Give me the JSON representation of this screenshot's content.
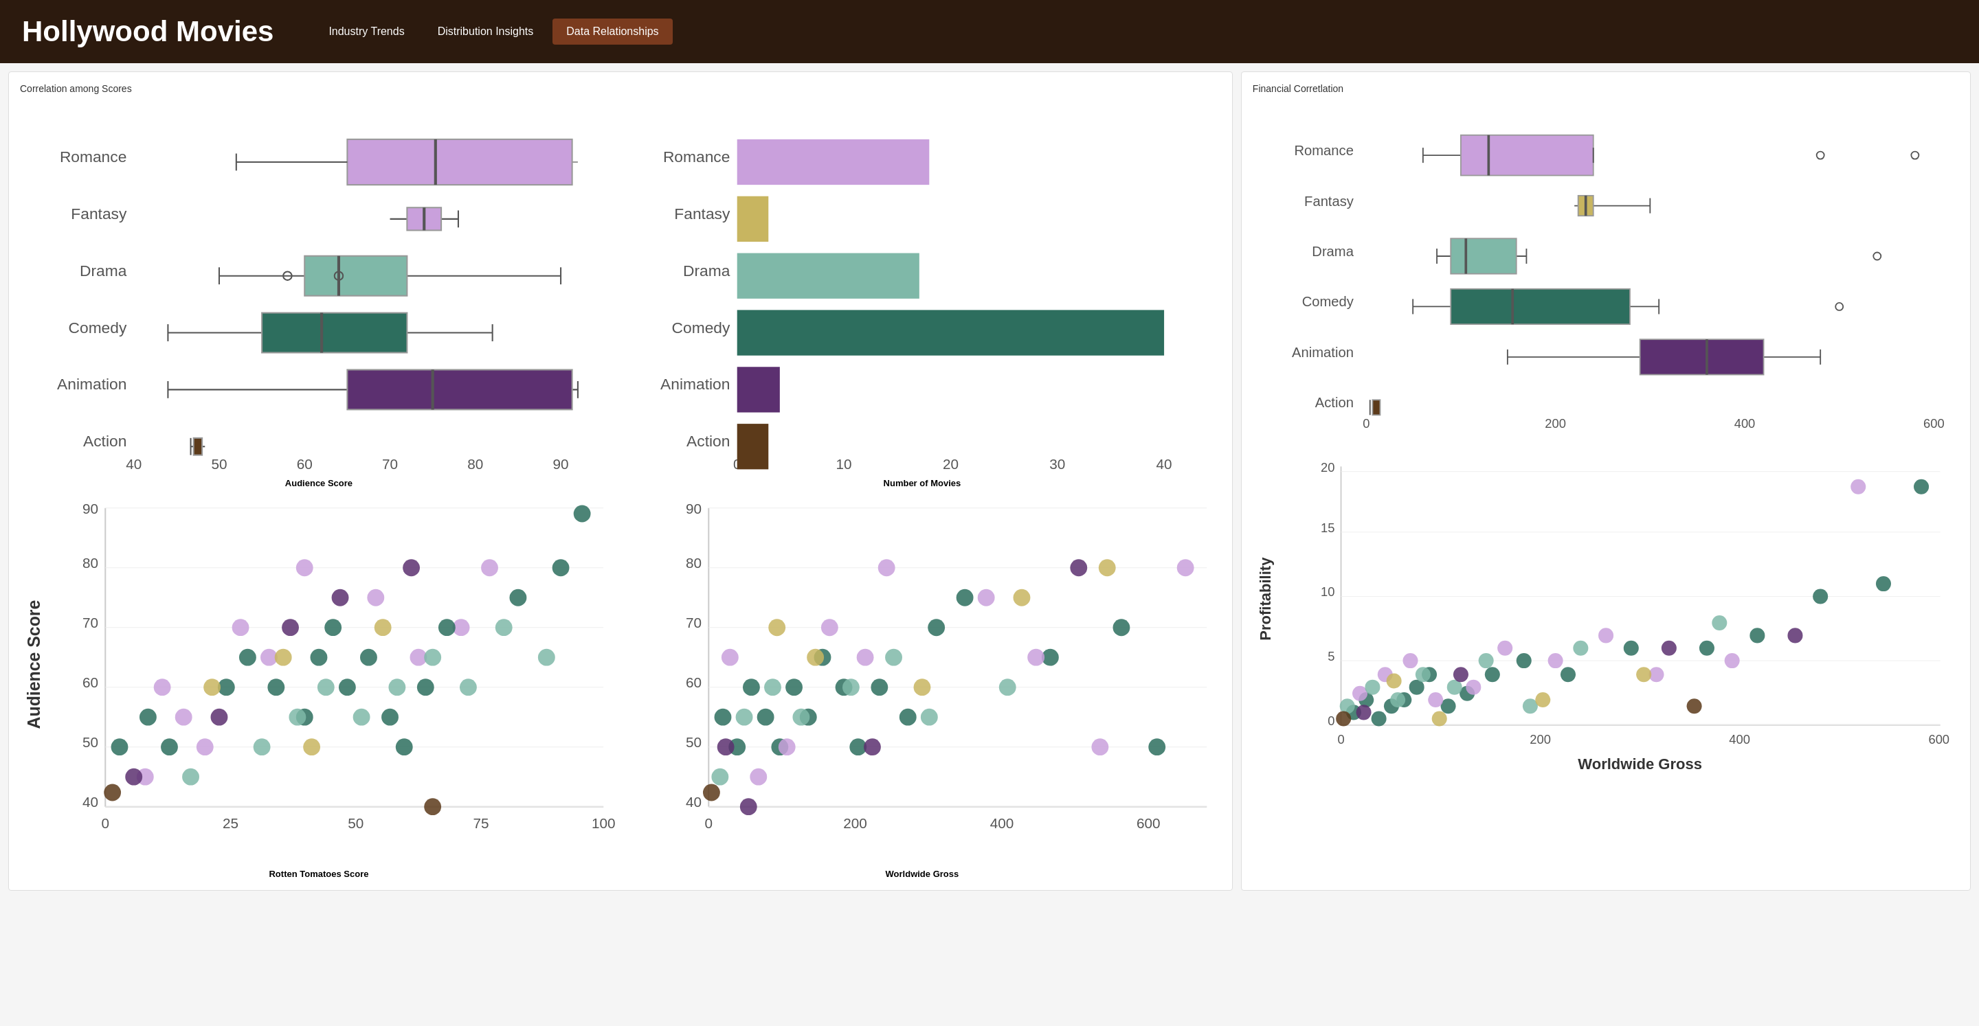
{
  "header": {
    "title": "Hollywood Movies",
    "nav": [
      {
        "label": "Industry Trends",
        "active": false
      },
      {
        "label": "Distribution Insights",
        "active": false
      },
      {
        "label": "Data Relationships",
        "active": true
      }
    ]
  },
  "panels": {
    "left": {
      "title": "Correlation among Scores",
      "charts": {
        "boxplot1": {
          "title": "Audience Score"
        },
        "bar1": {
          "title": "Number of Movies"
        },
        "scatter1": {
          "title": "Rotten Tomatoes Score",
          "yLabel": "Audience Score"
        },
        "scatter2": {
          "title": "Worldwide Gross"
        }
      }
    },
    "right": {
      "title": "Financial Corretlation",
      "charts": {
        "boxplot2": {},
        "scatter3": {
          "xLabel": "Worldwide Gross",
          "yLabel": "Profitability"
        }
      }
    }
  },
  "colors": {
    "romance": "#c9a0dc",
    "fantasy": "#c8b560",
    "drama": "#7fb8a8",
    "comedy": "#2d6e5e",
    "animation": "#5c3070",
    "action": "#5c3a1a",
    "accent": "#7a3b1e"
  }
}
